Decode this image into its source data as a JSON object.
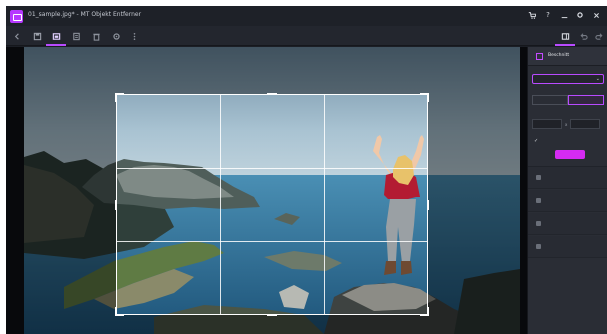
{
  "window": {
    "title": "01_sample.jpg* - MT Objekt Entferner",
    "controls": [
      "cart-icon",
      "help-icon",
      "minimize-icon",
      "settings-icon",
      "close-icon"
    ]
  },
  "toolbar": {
    "tools": [
      "back-icon",
      "save-icon",
      "crop-icon",
      "export-icon",
      "delete-icon",
      "undo-icon",
      "more-icon"
    ],
    "active_tool": "crop-icon",
    "right_tools": [
      "layers-icon",
      "undo-icon",
      "redo-icon"
    ]
  },
  "panel": {
    "header": "Beschnitt",
    "ratio_select": "",
    "orientation_label": "",
    "orientation_options": [
      "",
      ""
    ],
    "orientation_selected": 1,
    "size_label": "",
    "width": "",
    "height": "",
    "size_separator": "x",
    "keep_ratio_label": "",
    "apply_label": "",
    "items": [
      {
        "label": "",
        "icon": "filter-icon"
      },
      {
        "label": "",
        "icon": "adjust-icon"
      },
      {
        "label": "",
        "icon": "retouch-icon"
      },
      {
        "label": "",
        "icon": "text-icon"
      }
    ]
  },
  "colors": {
    "accent": "#b94bff",
    "apply_button": "#d52bf2",
    "window_bg": "#1b1e25",
    "panel_bg": "#2a2d35"
  }
}
